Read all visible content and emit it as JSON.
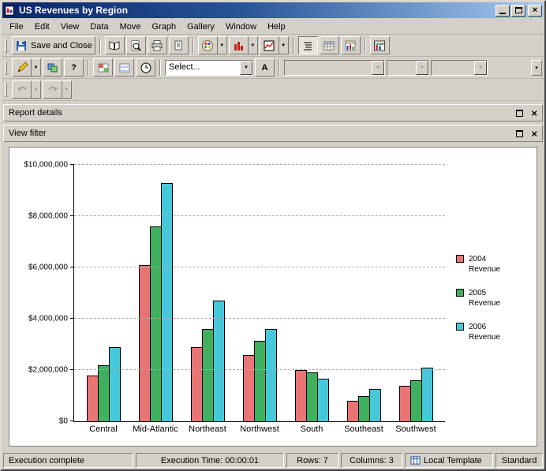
{
  "window": {
    "title": "US Revenues by Region"
  },
  "menu": {
    "items": [
      "File",
      "Edit",
      "View",
      "Data",
      "Move",
      "Graph",
      "Gallery",
      "Window",
      "Help"
    ]
  },
  "toolbar_main": {
    "save_and_close": "Save and Close"
  },
  "toolbar_format": {
    "autostyle_value": "Select...",
    "font_label": "A"
  },
  "panels": {
    "report_details": "Report details",
    "view_filter": "View filter"
  },
  "status_bar": {
    "execution": "Execution complete",
    "execution_time": "Execution Time: 00:00:01",
    "rows": "Rows: 7",
    "columns": "Columns: 3",
    "template": "Local Template",
    "mode": "Standard"
  },
  "glyphs": {
    "dropdown": "▼",
    "close": "×",
    "help": "?",
    "overflow": "▾"
  },
  "chart_data": {
    "type": "bar",
    "title": "",
    "categories": [
      "Central",
      "Mid-Atlantic",
      "Northeast",
      "Northwest",
      "South",
      "Southeast",
      "Southwest"
    ],
    "series": [
      {
        "name": "2004 Revenue",
        "color": "#e87474",
        "values": [
          1800000,
          6100000,
          2900000,
          2600000,
          2000000,
          800000,
          1400000
        ]
      },
      {
        "name": "2005 Revenue",
        "color": "#3fb05e",
        "values": [
          2200000,
          7600000,
          3600000,
          3150000,
          1900000,
          1000000,
          1600000
        ]
      },
      {
        "name": "2006 Revenue",
        "color": "#47c8da",
        "values": [
          2900000,
          9300000,
          4700000,
          3600000,
          1650000,
          1250000,
          2100000
        ]
      }
    ],
    "ylim": [
      0,
      10000000
    ],
    "ytick_interval": 2000000,
    "ytick_labels": [
      "$0",
      "$2,000,000",
      "$4,000,000",
      "$6,000,000",
      "$8,000,000",
      "$10,000,000"
    ],
    "xlabel": "",
    "ylabel": "",
    "grid": "horizontal-dashed",
    "legend_position": "right"
  }
}
